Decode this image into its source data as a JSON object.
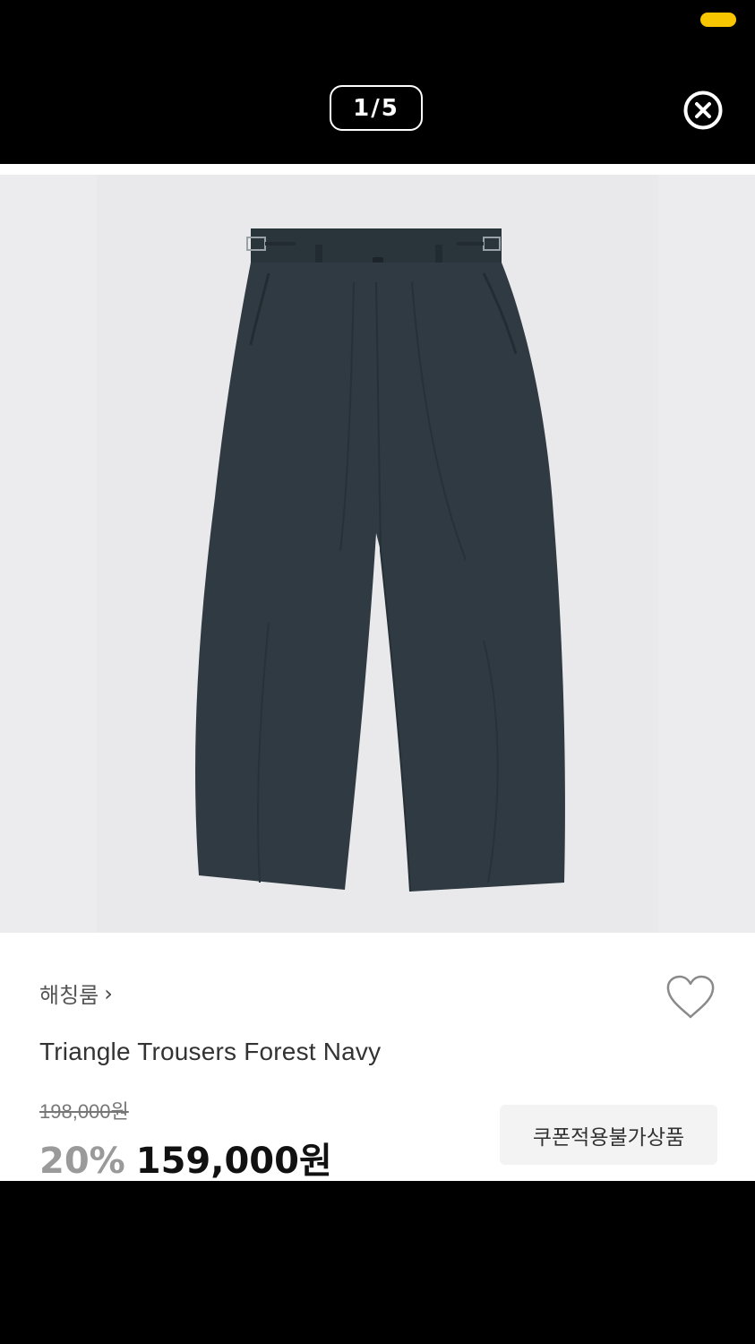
{
  "viewer": {
    "page_indicator": "1/5",
    "close_icon": "close-circle-icon"
  },
  "product": {
    "brand": "해칭룸",
    "brand_chevron": "›",
    "name": "Triangle Trousers Forest Navy",
    "original_price": "198,000원",
    "discount_rate": "20%",
    "sale_price": "159,000원",
    "coupon_notice": "쿠폰적용불가상품",
    "wishlist_icon": "heart-outline-icon"
  },
  "colors": {
    "status_indicator": "#f7c600",
    "photo_background": "#ececee",
    "trousers": "#2f3a42",
    "discount": "#9a9a9a"
  }
}
